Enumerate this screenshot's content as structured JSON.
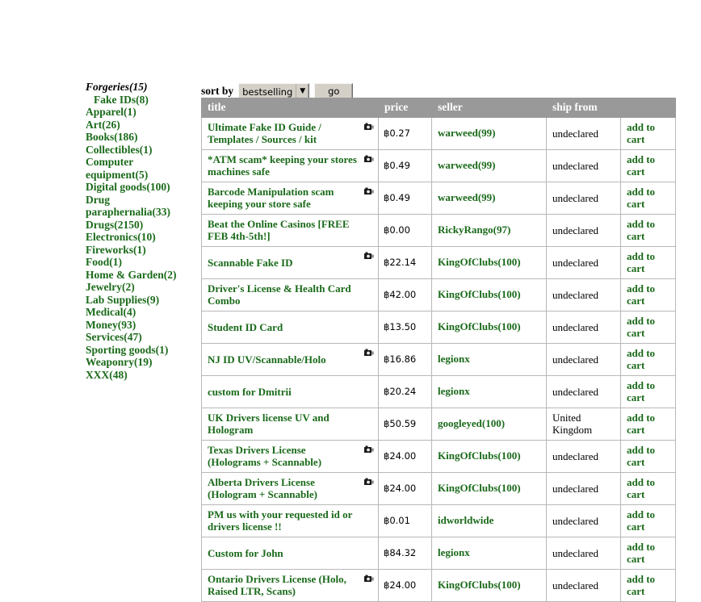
{
  "sidebar": {
    "categories": [
      {
        "label": "Forgeries(15)",
        "current": true,
        "sub": false
      },
      {
        "label": "Fake IDs(8)",
        "current": false,
        "sub": true
      },
      {
        "label": "Apparel(1)",
        "current": false,
        "sub": false
      },
      {
        "label": "Art(26)",
        "current": false,
        "sub": false
      },
      {
        "label": "Books(186)",
        "current": false,
        "sub": false
      },
      {
        "label": "Collectibles(1)",
        "current": false,
        "sub": false
      },
      {
        "label": "Computer equipment(5)",
        "current": false,
        "sub": false
      },
      {
        "label": "Digital goods(100)",
        "current": false,
        "sub": false
      },
      {
        "label": "Drug paraphernalia(33)",
        "current": false,
        "sub": false
      },
      {
        "label": "Drugs(2150)",
        "current": false,
        "sub": false
      },
      {
        "label": "Electronics(10)",
        "current": false,
        "sub": false
      },
      {
        "label": "Fireworks(1)",
        "current": false,
        "sub": false
      },
      {
        "label": "Food(1)",
        "current": false,
        "sub": false
      },
      {
        "label": "Home & Garden(2)",
        "current": false,
        "sub": false
      },
      {
        "label": "Jewelry(2)",
        "current": false,
        "sub": false
      },
      {
        "label": "Lab Supplies(9)",
        "current": false,
        "sub": false
      },
      {
        "label": "Medical(4)",
        "current": false,
        "sub": false
      },
      {
        "label": "Money(93)",
        "current": false,
        "sub": false
      },
      {
        "label": "Services(47)",
        "current": false,
        "sub": false
      },
      {
        "label": "Sporting goods(1)",
        "current": false,
        "sub": false
      },
      {
        "label": "Weaponry(19)",
        "current": false,
        "sub": false
      },
      {
        "label": "XXX(48)",
        "current": false,
        "sub": false
      }
    ]
  },
  "sortbar": {
    "label": "sort by",
    "selected": "bestselling",
    "options": [
      "bestselling"
    ],
    "caret": "▼",
    "go_label": "go"
  },
  "table": {
    "columns": [
      "title",
      "price",
      "seller",
      "ship from",
      ""
    ],
    "cart_label": "add to cart",
    "rows": [
      {
        "title": "Ultimate Fake ID Guide / Templates / Sources / kit",
        "has_image": true,
        "price": "฿0.27",
        "seller": "warweed(99)",
        "ship": "undeclared"
      },
      {
        "title": "*ATM scam* keeping your stores machines safe",
        "has_image": true,
        "price": "฿0.49",
        "seller": "warweed(99)",
        "ship": "undeclared"
      },
      {
        "title": "Barcode Manipulation scam keeping your store safe",
        "has_image": true,
        "price": "฿0.49",
        "seller": "warweed(99)",
        "ship": "undeclared"
      },
      {
        "title": "Beat the Online Casinos [FREE FEB 4th-5th!]",
        "has_image": false,
        "price": "฿0.00",
        "seller": "RickyRango(97)",
        "ship": "undeclared"
      },
      {
        "title": "Scannable Fake ID",
        "has_image": true,
        "price": "฿22.14",
        "seller": "KingOfClubs(100)",
        "ship": "undeclared"
      },
      {
        "title": "Driver's License & Health Card Combo",
        "has_image": false,
        "price": "฿42.00",
        "seller": "KingOfClubs(100)",
        "ship": "undeclared"
      },
      {
        "title": "Student ID Card",
        "has_image": false,
        "price": "฿13.50",
        "seller": "KingOfClubs(100)",
        "ship": "undeclared"
      },
      {
        "title": "NJ ID UV/Scannable/Holo",
        "has_image": true,
        "price": "฿16.86",
        "seller": "legionx",
        "ship": "undeclared"
      },
      {
        "title": "custom for Dmitrii",
        "has_image": false,
        "price": "฿20.24",
        "seller": "legionx",
        "ship": "undeclared"
      },
      {
        "title": "UK Drivers license UV and Hologram",
        "has_image": false,
        "price": "฿50.59",
        "seller": "googleyed(100)",
        "ship": "United Kingdom"
      },
      {
        "title": "Texas Drivers License (Holograms + Scannable)",
        "has_image": true,
        "price": "฿24.00",
        "seller": "KingOfClubs(100)",
        "ship": "undeclared"
      },
      {
        "title": "Alberta Drivers License (Hologram + Scannable)",
        "has_image": true,
        "price": "฿24.00",
        "seller": "KingOfClubs(100)",
        "ship": "undeclared"
      },
      {
        "title": "PM us with your requested id or drivers license !!",
        "has_image": false,
        "price": "฿0.01",
        "seller": "idworldwide",
        "ship": "undeclared"
      },
      {
        "title": "Custom for John",
        "has_image": false,
        "price": "฿84.32",
        "seller": "legionx",
        "ship": "undeclared"
      },
      {
        "title": "Ontario Drivers License (Holo, Raised LTR, Scans)",
        "has_image": true,
        "price": "฿24.00",
        "seller": "KingOfClubs(100)",
        "ship": "undeclared"
      }
    ]
  },
  "colors": {
    "link_green": "#1a6a1a",
    "header_grey": "#999999",
    "border_grey": "#b8b8b8",
    "chrome_grey": "#d4d0c8"
  }
}
